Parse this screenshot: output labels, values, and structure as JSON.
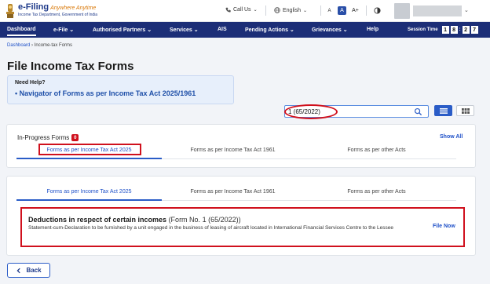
{
  "header": {
    "logo_title": "e-Filing",
    "logo_tagline": "Anywhere Anytime",
    "logo_subtitle": "Income Tax Department, Government of India",
    "call_us": "Call Us",
    "language": "English",
    "font_small": "A",
    "font_normal": "A",
    "font_large": "A+"
  },
  "nav": {
    "items": [
      "Dashboard",
      "e-File",
      "Authorised Partners",
      "Services",
      "AIS",
      "Pending Actions",
      "Grievances",
      "Help"
    ],
    "session_label": "Session Time",
    "session_digits": [
      "1",
      "8",
      "2",
      "7"
    ]
  },
  "breadcrumb": {
    "home": "Dashboard",
    "current": "Income-tax Forms"
  },
  "page_title": "File Income Tax Forms",
  "help": {
    "heading": "Need Help?",
    "link": "Navigator of Forms as per Income Tax Act 2025/1961"
  },
  "search": {
    "value": "1 (65/2022)"
  },
  "in_progress": {
    "label": "In-Progress Forms",
    "count": "0",
    "show_all": "Show All",
    "tabs": [
      "Forms as per Income Tax Act 2025",
      "Forms as per Income Tax Act 1961",
      "Forms as per other Acts"
    ]
  },
  "forms_section": {
    "tabs": [
      "Forms as per Income Tax Act 2025",
      "Forms as per Income Tax Act 1961",
      "Forms as per other Acts"
    ],
    "result": {
      "title": "Deductions in respect of certain incomes",
      "code": "(Form No. 1 (65/2022))",
      "description": "Statement-cum-Declaration to be furnished by a unit engaged in the business of leasing of aircraft located in International Financial Services Centre to the Lessee",
      "action": "File Now"
    }
  },
  "back_button": "Back",
  "colors": {
    "nav_bg": "#1c2e77",
    "accent": "#2a5cc7",
    "highlight": "#d0101d"
  }
}
